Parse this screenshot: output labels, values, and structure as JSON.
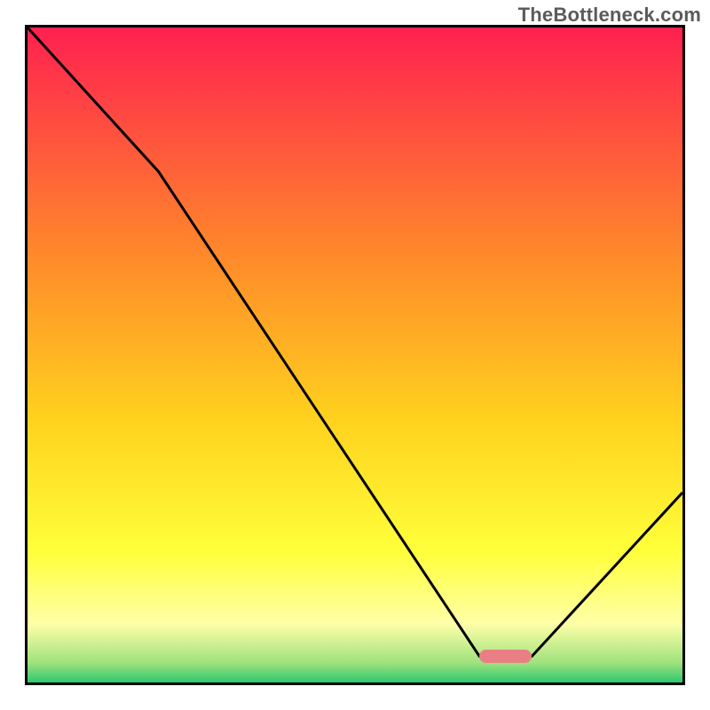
{
  "watermark": "TheBottleneck.com",
  "chart_data": {
    "type": "line",
    "title": "",
    "xlabel": "",
    "ylabel": "",
    "xlim": [
      0,
      100
    ],
    "ylim": [
      0,
      100
    ],
    "grid": false,
    "legend": false,
    "background_gradient": {
      "stops": [
        {
          "pos": 0.0,
          "color": "#ff2050"
        },
        {
          "pos": 0.35,
          "color": "#ff8a2a"
        },
        {
          "pos": 0.6,
          "color": "#ffd21e"
        },
        {
          "pos": 0.8,
          "color": "#ffff3a"
        },
        {
          "pos": 0.91,
          "color": "#ffffa8"
        },
        {
          "pos": 0.97,
          "color": "#9fe27e"
        },
        {
          "pos": 1.0,
          "color": "#2fc76e"
        }
      ]
    },
    "series": [
      {
        "name": "bottleneck-curve",
        "color": "#000000",
        "x": [
          0,
          20,
          69,
          77,
          100
        ],
        "values": [
          100,
          78,
          4,
          4,
          29
        ]
      }
    ],
    "marker": {
      "name": "optimal-range",
      "color": "#e97f85",
      "x_start": 69,
      "x_end": 77,
      "y": 4,
      "thickness_pct": 2
    }
  }
}
